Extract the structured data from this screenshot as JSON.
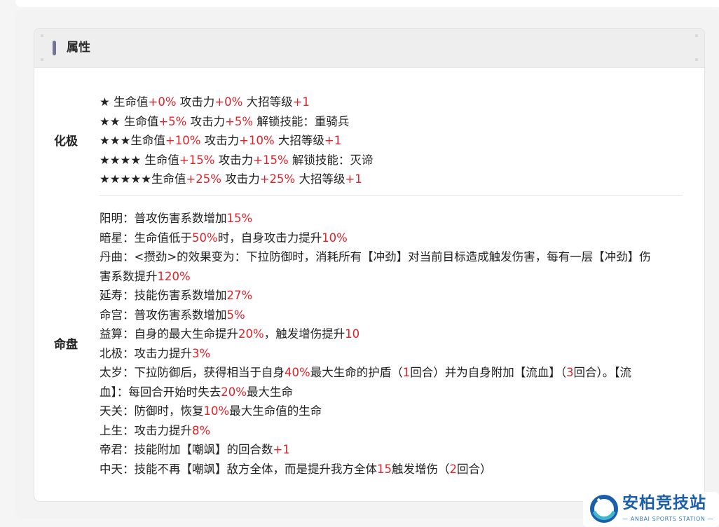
{
  "section_title": "属性",
  "huaji": {
    "label": "化极",
    "lines": [
      [
        {
          "t": "★ 生命值"
        },
        {
          "t": "+0%",
          "red": true
        },
        {
          "t": " 攻击力"
        },
        {
          "t": "+0%",
          "red": true
        },
        {
          "t": " 大招等级"
        },
        {
          "t": "+1",
          "red": true
        }
      ],
      [
        {
          "t": "★★ 生命值"
        },
        {
          "t": "+5%",
          "red": true
        },
        {
          "t": " 攻击力"
        },
        {
          "t": "+5%",
          "red": true
        },
        {
          "t": " 解锁技能：重骑兵"
        }
      ],
      [
        {
          "t": "★★★生命值"
        },
        {
          "t": "+10%",
          "red": true
        },
        {
          "t": " 攻击力"
        },
        {
          "t": "+10%",
          "red": true
        },
        {
          "t": " 大招等级"
        },
        {
          "t": "+1",
          "red": true
        }
      ],
      [
        {
          "t": "★★★★ 生命值"
        },
        {
          "t": "+15%",
          "red": true
        },
        {
          "t": " 攻击力"
        },
        {
          "t": "+15%",
          "red": true
        },
        {
          "t": " 解锁技能：灭谛"
        }
      ],
      [
        {
          "t": "★★★★★生命值"
        },
        {
          "t": "+25%",
          "red": true
        },
        {
          "t": " 攻击力"
        },
        {
          "t": "+25%",
          "red": true
        },
        {
          "t": " 大招等级"
        },
        {
          "t": "+1",
          "red": true
        }
      ]
    ]
  },
  "mingpan": {
    "label": "命盘",
    "lines": [
      [
        {
          "t": "阳明：普攻伤害系数增加"
        },
        {
          "t": "15%",
          "red": true
        }
      ],
      [
        {
          "t": "暗星：生命值低于"
        },
        {
          "t": "50%",
          "red": true
        },
        {
          "t": "时，自身攻击力提升"
        },
        {
          "t": "10%",
          "red": true
        }
      ],
      [
        {
          "t": "丹曲：<攒劲>的效果变为：下拉防御时，消耗所有【冲劲】对当前目标造成触发伤害，每有一层【冲劲】伤"
        }
      ],
      [
        {
          "t": "害系数提升"
        },
        {
          "t": "120%",
          "red": true
        }
      ],
      [
        {
          "t": "延寿：技能伤害系数增加"
        },
        {
          "t": "27%",
          "red": true
        }
      ],
      [
        {
          "t": "命宫：普攻伤害系数增加"
        },
        {
          "t": "5%",
          "red": true
        }
      ],
      [
        {
          "t": "益算：自身的最大生命提升"
        },
        {
          "t": "20%",
          "red": true
        },
        {
          "t": "，触发增伤提升"
        },
        {
          "t": "10",
          "red": true
        }
      ],
      [
        {
          "t": "北极：攻击力提升"
        },
        {
          "t": "3%",
          "red": true
        }
      ],
      [
        {
          "t": "太岁：下拉防御后，获得相当于自身"
        },
        {
          "t": "40%",
          "red": true
        },
        {
          "t": "最大生命的护盾（"
        },
        {
          "t": "1",
          "red": true
        },
        {
          "t": "回合）并为自身附加【流血】（"
        },
        {
          "t": "3",
          "red": true
        },
        {
          "t": "回合）。【流"
        }
      ],
      [
        {
          "t": "血】：每回合开始时失去"
        },
        {
          "t": "20%",
          "red": true
        },
        {
          "t": "最大生命"
        }
      ],
      [
        {
          "t": "天关：防御时，恢复"
        },
        {
          "t": "10%",
          "red": true
        },
        {
          "t": "最大生命值的生命"
        }
      ],
      [
        {
          "t": "上生：攻击力提升"
        },
        {
          "t": "8%",
          "red": true
        }
      ],
      [
        {
          "t": "帝君：技能附加【嘲飒】的回合数"
        },
        {
          "t": "+1",
          "red": true
        }
      ],
      [
        {
          "t": "中天：技能不再【嘲飒】敌方全体，而是提升我方全体"
        },
        {
          "t": "15",
          "red": true
        },
        {
          "t": "触发增伤（"
        },
        {
          "t": "2",
          "red": true
        },
        {
          "t": "回合）"
        }
      ]
    ]
  },
  "watermark": {
    "name": "安柏竞技站",
    "sub": "— ANBAI SPORTS STATION —"
  },
  "colors": {
    "highlight": "#e0232a",
    "header_bar": "#707594",
    "brand": "#1b5ea9"
  }
}
